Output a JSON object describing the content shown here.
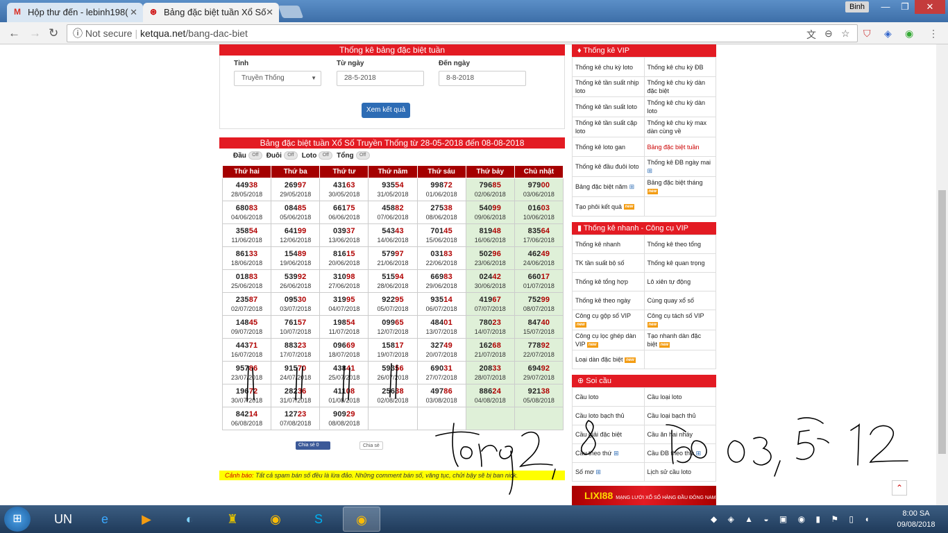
{
  "browser": {
    "tabs": [
      {
        "label": "Hộp thư đến - lebinh198(",
        "icon": "gmail-icon"
      },
      {
        "label": "Bảng đặc biệt tuần Xổ Số",
        "icon": "site-icon"
      }
    ],
    "user": "Binh",
    "not_secure": "Not secure",
    "url_host": "ketqua.net",
    "url_path": "/bang-dac-biet"
  },
  "filter": {
    "header": "Thống kê bảng đặc biệt tuần",
    "province_label": "Tỉnh",
    "province_value": "Truyền Thống",
    "from_label": "Từ ngày",
    "from_value": "28-5-2018",
    "to_label": "Đến ngày",
    "to_value": "8-8-2018",
    "submit": "Xem kết quả"
  },
  "table_title": "Bảng đặc biệt tuần Xổ Số Truyền Thống từ 28-05-2018 đến 08-08-2018",
  "toggles": {
    "dau": "Đầu",
    "duoi": "Đuôi",
    "loto": "Loto",
    "tong": "Tổng",
    "off": "Off"
  },
  "days": [
    "Thứ hai",
    "Thứ ba",
    "Thứ tư",
    "Thứ năm",
    "Thứ sáu",
    "Thứ bảy",
    "Chủ nhật"
  ],
  "rows": [
    [
      [
        "44938",
        "28/05/2018"
      ],
      [
        "26997",
        "29/05/2018"
      ],
      [
        "43163",
        "30/05/2018"
      ],
      [
        "93554",
        "31/05/2018"
      ],
      [
        "99872",
        "01/06/2018"
      ],
      [
        "79685",
        "02/06/2018"
      ],
      [
        "97900",
        "03/06/2018"
      ]
    ],
    [
      [
        "68083",
        "04/06/2018"
      ],
      [
        "08485",
        "05/06/2018"
      ],
      [
        "66175",
        "06/06/2018"
      ],
      [
        "45882",
        "07/06/2018"
      ],
      [
        "27538",
        "08/06/2018"
      ],
      [
        "54099",
        "09/06/2018"
      ],
      [
        "01603",
        "10/06/2018"
      ]
    ],
    [
      [
        "35854",
        "11/06/2018"
      ],
      [
        "64199",
        "12/06/2018"
      ],
      [
        "03937",
        "13/06/2018"
      ],
      [
        "54343",
        "14/06/2018"
      ],
      [
        "70145",
        "15/06/2018"
      ],
      [
        "81948",
        "16/06/2018"
      ],
      [
        "83564",
        "17/06/2018"
      ]
    ],
    [
      [
        "86133",
        "18/06/2018"
      ],
      [
        "15489",
        "19/06/2018"
      ],
      [
        "81615",
        "20/06/2018"
      ],
      [
        "57997",
        "21/06/2018"
      ],
      [
        "03183",
        "22/06/2018"
      ],
      [
        "50296",
        "23/06/2018"
      ],
      [
        "46249",
        "24/06/2018"
      ]
    ],
    [
      [
        "01883",
        "25/06/2018"
      ],
      [
        "53992",
        "26/06/2018"
      ],
      [
        "31098",
        "27/06/2018"
      ],
      [
        "51594",
        "28/06/2018"
      ],
      [
        "66983",
        "29/06/2018"
      ],
      [
        "02442",
        "30/06/2018"
      ],
      [
        "66017",
        "01/07/2018"
      ]
    ],
    [
      [
        "23587",
        "02/07/2018"
      ],
      [
        "09530",
        "03/07/2018"
      ],
      [
        "31995",
        "04/07/2018"
      ],
      [
        "92295",
        "05/07/2018"
      ],
      [
        "93514",
        "06/07/2018"
      ],
      [
        "41967",
        "07/07/2018"
      ],
      [
        "75299",
        "08/07/2018"
      ]
    ],
    [
      [
        "14845",
        "09/07/2018"
      ],
      [
        "76157",
        "10/07/2018"
      ],
      [
        "19854",
        "11/07/2018"
      ],
      [
        "09965",
        "12/07/2018"
      ],
      [
        "48401",
        "13/07/2018"
      ],
      [
        "78023",
        "14/07/2018"
      ],
      [
        "84740",
        "15/07/2018"
      ]
    ],
    [
      [
        "44371",
        "16/07/2018"
      ],
      [
        "88323",
        "17/07/2018"
      ],
      [
        "09669",
        "18/07/2018"
      ],
      [
        "15817",
        "19/07/2018"
      ],
      [
        "32749",
        "20/07/2018"
      ],
      [
        "16268",
        "21/07/2018"
      ],
      [
        "77892",
        "22/07/2018"
      ]
    ],
    [
      [
        "95786",
        "23/07/2018"
      ],
      [
        "91570",
        "24/07/2018"
      ],
      [
        "43841",
        "25/07/2018"
      ],
      [
        "59356",
        "26/07/2018"
      ],
      [
        "69031",
        "27/07/2018"
      ],
      [
        "20833",
        "28/07/2018"
      ],
      [
        "69492",
        "29/07/2018"
      ]
    ],
    [
      [
        "19672",
        "30/07/2018"
      ],
      [
        "28236",
        "31/07/2018"
      ],
      [
        "41108",
        "01/08/2018"
      ],
      [
        "25638",
        "02/08/2018"
      ],
      [
        "49786",
        "03/08/2018"
      ],
      [
        "88624",
        "04/08/2018"
      ],
      [
        "92138",
        "05/08/2018"
      ]
    ],
    [
      [
        "84214",
        "06/08/2018"
      ],
      [
        "12723",
        "07/08/2018"
      ],
      [
        "90929",
        "08/08/2018"
      ],
      [
        "",
        ""
      ],
      [
        "",
        ""
      ],
      [
        "",
        ""
      ],
      [
        "",
        ""
      ]
    ]
  ],
  "share": {
    "facebook": "Chia sẻ 0",
    "google": "Chia sẻ"
  },
  "warning": {
    "label": "Cảnh báo:",
    "text": "Tất cả spam bán số đều là lừa đảo. Những comment bán số, văng tục, chửi bậy sẽ bị ban nick."
  },
  "sidebar": {
    "vip_title": "Thống kê VIP",
    "vip_items": [
      [
        "Thống kê chu kỳ loto",
        "Thống kê chu kỳ ĐB"
      ],
      [
        "Thống kê tần suất nhịp loto",
        "Thống kê chu kỳ dàn đặc biệt"
      ],
      [
        "Thống kê tần suất loto",
        "Thống kê chu kỳ dàn loto"
      ],
      [
        "Thống kê tần suất cặp loto",
        "Thống kê chu kỳ max dàn cùng về"
      ],
      [
        "Thống kê loto gan",
        "Bảng đặc biệt tuần"
      ],
      [
        "Thống kê đầu đuôi loto",
        "Thống kê ĐB ngày mai"
      ],
      [
        "Bảng đặc biệt năm",
        "Bảng đặc biệt tháng"
      ],
      [
        "Tạo phôi kết quả",
        ""
      ]
    ],
    "quick_title": "Thống kê nhanh - Công cụ VIP",
    "quick_items": [
      [
        "Thống kê nhanh",
        "Thống kê theo tổng"
      ],
      [
        "TK tần suất bộ số",
        "Thống kê quan trọng"
      ],
      [
        "Thống kê tổng hợp",
        "Lô xiên tự động"
      ],
      [
        "Thống kê theo ngày",
        "Cùng quay xổ số"
      ],
      [
        "Công cụ gộp số VIP",
        "Công cụ tách số VIP"
      ],
      [
        "Công cụ lọc ghép dàn VIP",
        "Tạo nhanh dàn đặc biệt"
      ],
      [
        "Loại dàn đặc biệt",
        ""
      ]
    ],
    "soi_title": "Soi cầu",
    "soi_items": [
      [
        "Cầu loto",
        "Cầu loại loto"
      ],
      [
        "Cầu loto bạch thủ",
        "Cầu loại bạch thủ"
      ],
      [
        "Cầu giải đặc biệt",
        "Cầu ăn hai nháy"
      ],
      [
        "Cầu theo thứ",
        "Cầu ĐB theo thứ"
      ],
      [
        "Số mơ",
        "Lịch sử cầu loto"
      ]
    ],
    "new_badge": "new",
    "banner": "LIXI88",
    "banner_sub": "MẠNG LƯỚI XỔ SỐ HÀNG ĐẦU ĐÔNG NAM Á"
  },
  "taskbar": {
    "time": "8:00 SA",
    "date": "09/08/2018"
  },
  "colors": {
    "accent_red": "#e31b23",
    "header_dark_red": "#a50000",
    "weekend_green": "#dff0d8",
    "button_blue": "#2d6cb5"
  }
}
